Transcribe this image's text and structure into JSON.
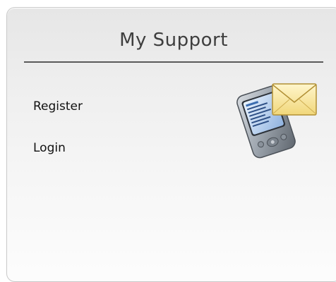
{
  "panel": {
    "title": "My Support",
    "links": [
      {
        "label": "Register"
      },
      {
        "label": "Login"
      }
    ],
    "icon": "pda-mail-icon"
  }
}
